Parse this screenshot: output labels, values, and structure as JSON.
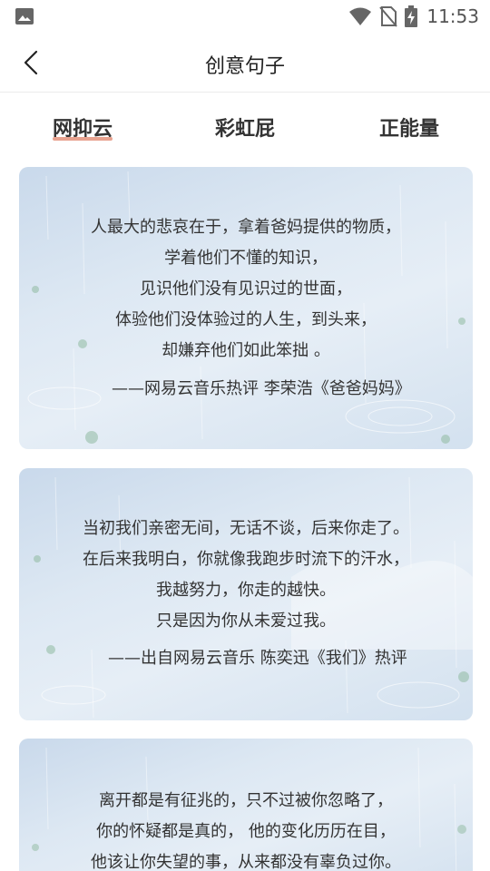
{
  "status_bar": {
    "time": "11:53",
    "icons": [
      "image-icon",
      "wifi-icon",
      "no-sim-icon",
      "battery-charging-icon"
    ]
  },
  "nav": {
    "title": "创意句子",
    "back_icon": "chevron-left-icon"
  },
  "tabs": [
    {
      "label": "网抑云",
      "active": true
    },
    {
      "label": "彩虹屁",
      "active": false
    },
    {
      "label": "正能量",
      "active": false
    }
  ],
  "colors": {
    "accent_underline": "#e8a28f",
    "card_background": "#d8e4f0"
  },
  "cards": [
    {
      "lines": [
        "人最大的悲哀在于，拿着爸妈提供的物质，",
        "学着他们不懂的知识，",
        "见识他们没有见识过的世面，",
        "体验他们没体验过的人生，到头来，",
        "却嫌弃他们如此笨拙 。"
      ],
      "source": "——网易云音乐热评 李荣浩《爸爸妈妈》"
    },
    {
      "lines": [
        "当初我们亲密无间，无话不谈，后来你走了。",
        "在后来我明白，你就像我跑步时流下的汗水，",
        "我越努力，你走的越快。",
        "只是因为你从未爱过我。"
      ],
      "source": "——出自网易云音乐 陈奕迅《我们》热评"
    },
    {
      "lines": [
        "离开都是有征兆的，只不过被你忽略了，",
        "你的怀疑都是真的， 他的变化历历在目，",
        "他该让你失望的事，从来都没有辜负过你。"
      ],
      "source": ""
    }
  ]
}
